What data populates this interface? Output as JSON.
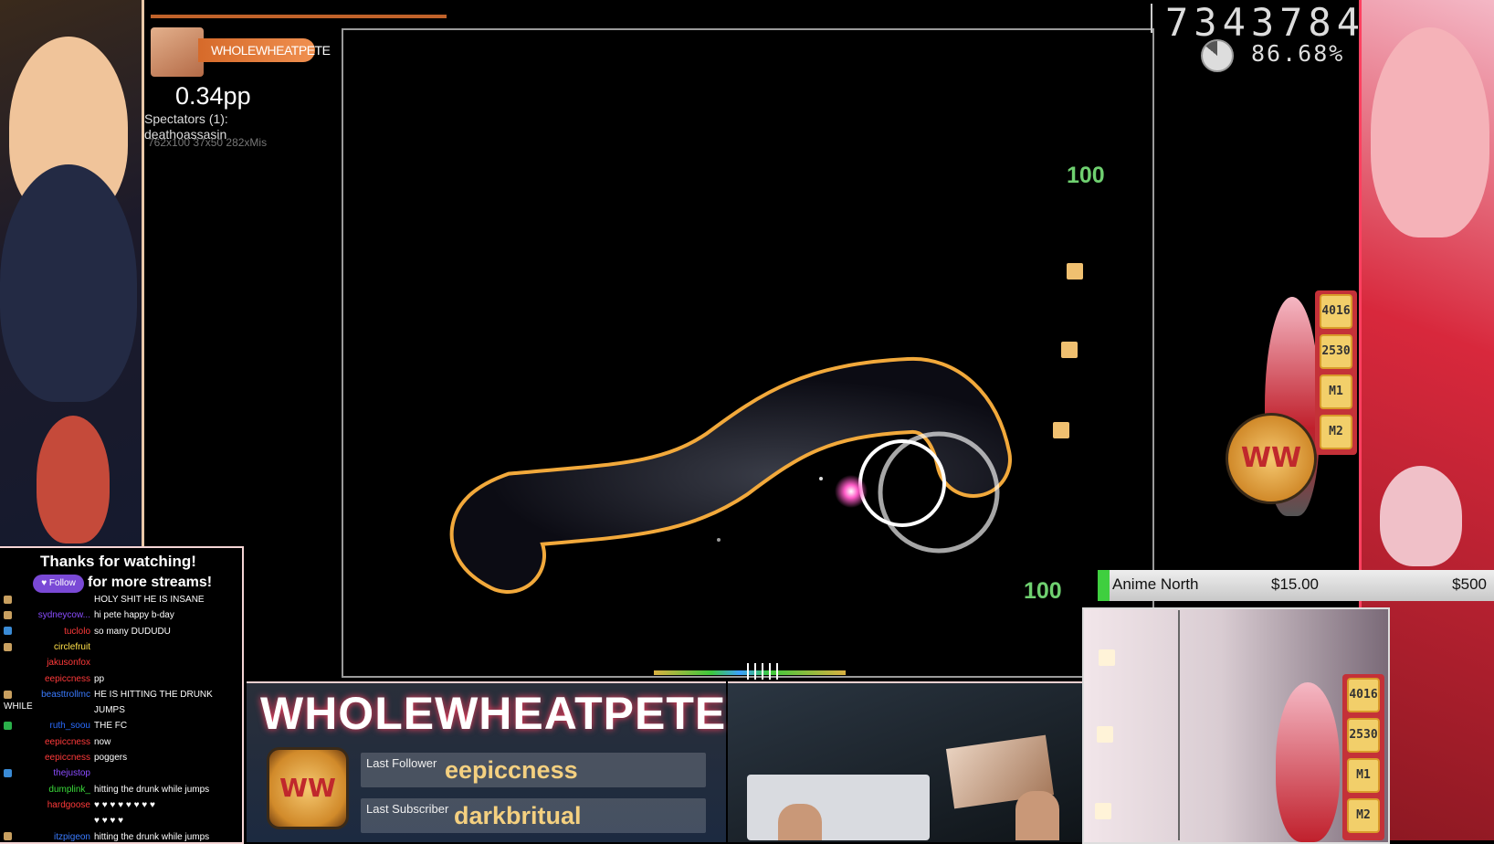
{
  "player": {
    "name": "WHOLEWHEATPETE"
  },
  "performance": {
    "pp": "0.34pp",
    "spectators_label": "Spectators (1):",
    "spectator": "deathoassasin",
    "stats_line": "762x100 37x50 282xMis"
  },
  "score": {
    "value": "7343784",
    "accuracy": "86.68%",
    "accuracy_fraction": 0.8668
  },
  "hits": {
    "first": "100",
    "second": "100"
  },
  "keys": {
    "top": [
      "4016",
      "2530",
      "M1",
      "M2"
    ],
    "bottom": [
      "4016",
      "2530",
      "M1",
      "M2"
    ]
  },
  "donation": {
    "label": "Anime North",
    "current": "$15.00",
    "goal": "$500",
    "fraction": 0.03
  },
  "overlay": {
    "thanks": "Thanks for watching!",
    "follow_button": "Follow",
    "more_streams": "for more streams!",
    "banner_name": "WHOLEWHEATPETE",
    "logo_text": "WW",
    "last_follower_label": "Last Follower",
    "last_follower": "eepiccness",
    "last_subscriber_label": "Last Subscriber",
    "last_subscriber": "darkbritual"
  },
  "chat": [
    {
      "user": "",
      "msg": "HOLY SHIT HE IS INSANE",
      "color": "#3a7bff",
      "badge": "#c9a060"
    },
    {
      "user": "sydneycow...",
      "msg": "hi pete happy b-day",
      "color": "#8a4cff",
      "badge": "#c9a060"
    },
    {
      "user": "tuclolo",
      "msg": "so many DUDUDU",
      "color": "#ff3a3a",
      "badge": "#3a8bd6"
    },
    {
      "user": "circlefruit",
      "msg": "",
      "color": "#ffe04a",
      "badge": "#c9a060"
    },
    {
      "user": "jakusonfox",
      "msg": "",
      "color": "#ff3a3a",
      "badge": ""
    },
    {
      "user": "eepiccness",
      "msg": "pp",
      "color": "#ff3a3a",
      "badge": ""
    },
    {
      "user": "beasttrollmc",
      "msg": "HE IS HITTING THE DRUNK WHILE",
      "color": "#3a7bff",
      "badge": "#c9a060"
    },
    {
      "user": "",
      "msg": "JUMPS",
      "color": "#3a7bff",
      "badge": ""
    },
    {
      "user": "ruth_soou",
      "msg": "THE FC",
      "color": "#2a6cff",
      "badge": "#2ab04a"
    },
    {
      "user": "eepiccness",
      "msg": "now",
      "color": "#ff3a3a",
      "badge": ""
    },
    {
      "user": "eepiccness",
      "msg": "poggers",
      "color": "#ff3a3a",
      "badge": ""
    },
    {
      "user": "thejustop",
      "msg": "",
      "color": "#8a4cff",
      "badge": "#3a8bd6"
    },
    {
      "user": "dumplink_",
      "msg": "hitting the drunk while jumps",
      "color": "#3adc3a",
      "badge": ""
    },
    {
      "user": "hardgoose",
      "msg": "♥ ♥ ♥ ♥ ♥ ♥ ♥ ♥",
      "color": "#ff3a3a",
      "badge": ""
    },
    {
      "user": "",
      "msg": "♥ ♥ ♥ ♥",
      "color": "#ff3a3a",
      "badge": ""
    },
    {
      "user": "itzpigeon",
      "msg": "hitting the drunk while jumps",
      "color": "#3a7bff",
      "badge": "#c9a060"
    }
  ],
  "colors": {
    "slider_border": "#f2a93b",
    "cursor": "#ff5cc8",
    "hit100": "#6fd070"
  }
}
